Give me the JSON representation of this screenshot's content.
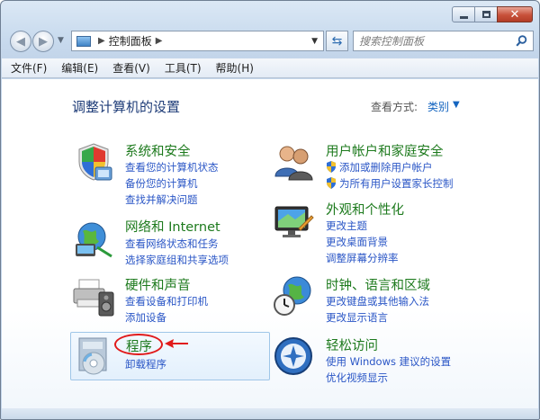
{
  "window": {
    "address": {
      "path": "控制面板"
    },
    "search": {
      "placeholder": "搜索控制面板"
    }
  },
  "menubar": {
    "items": [
      {
        "label": "文件(F)"
      },
      {
        "label": "编辑(E)"
      },
      {
        "label": "查看(V)"
      },
      {
        "label": "工具(T)"
      },
      {
        "label": "帮助(H)"
      }
    ]
  },
  "content": {
    "title": "调整计算机的设置",
    "view_by_label": "查看方式:",
    "view_by_value": "类别"
  },
  "categories": {
    "system_security": {
      "title": "系统和安全",
      "links": [
        "查看您的计算机状态",
        "备份您的计算机",
        "查找并解决问题"
      ]
    },
    "network": {
      "title": "网络和 Internet",
      "links": [
        "查看网络状态和任务",
        "选择家庭组和共享选项"
      ]
    },
    "hardware": {
      "title": "硬件和声音",
      "links": [
        "查看设备和打印机",
        "添加设备"
      ]
    },
    "programs": {
      "title": "程序",
      "links": [
        "卸载程序"
      ]
    },
    "user_accounts": {
      "title": "用户帐户和家庭安全",
      "links": [
        "添加或删除用户帐户",
        "为所有用户设置家长控制"
      ]
    },
    "appearance": {
      "title": "外观和个性化",
      "links": [
        "更改主题",
        "更改桌面背景",
        "调整屏幕分辨率"
      ]
    },
    "clock": {
      "title": "时钟、语言和区域",
      "links": [
        "更改键盘或其他输入法",
        "更改显示语言"
      ]
    },
    "ease": {
      "title": "轻松访问",
      "links": [
        "使用 Windows 建议的设置",
        "优化视频显示"
      ]
    }
  },
  "colors": {
    "category_title": "#1d7a1d",
    "link": "#2a56c6",
    "annotation": "#e11a1a"
  }
}
